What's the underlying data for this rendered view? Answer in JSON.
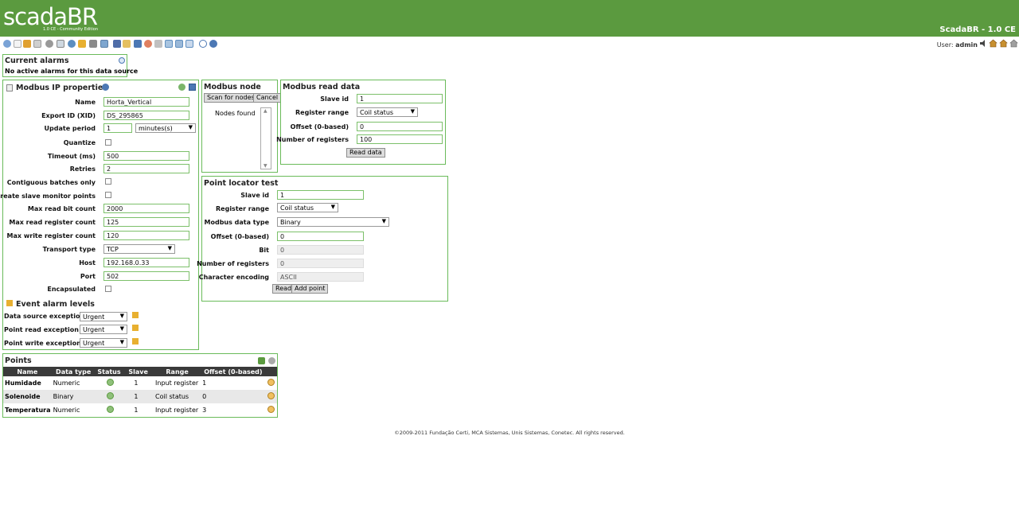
{
  "header": {
    "logo": "scadaBR",
    "logo_sub": "1.0 CE - Community Edition",
    "title": "ScadaBR - 1.0 CE"
  },
  "toolbar": {
    "user_label": "User:",
    "user_name": "admin"
  },
  "alarms": {
    "title": "Current alarms",
    "message": "No active alarms for this data source"
  },
  "props": {
    "title": "Modbus IP properties",
    "fields": {
      "name": {
        "label": "Name",
        "value": "Horta_Vertical"
      },
      "xid": {
        "label": "Export ID (XID)",
        "value": "DS_295865"
      },
      "period": {
        "label": "Update period",
        "value": "1",
        "unit": "minutes(s)"
      },
      "quantize": {
        "label": "Quantize"
      },
      "timeout": {
        "label": "Timeout (ms)",
        "value": "500"
      },
      "retries": {
        "label": "Retries",
        "value": "2"
      },
      "contiguous": {
        "label": "Contiguous batches only"
      },
      "slave_monitor": {
        "label": "Create slave monitor points"
      },
      "max_bit": {
        "label": "Max read bit count",
        "value": "2000"
      },
      "max_reg": {
        "label": "Max read register count",
        "value": "125"
      },
      "max_write": {
        "label": "Max write register count",
        "value": "120"
      },
      "transport": {
        "label": "Transport type",
        "value": "TCP"
      },
      "host": {
        "label": "Host",
        "value": "192.168.0.33"
      },
      "port": {
        "label": "Port",
        "value": "502"
      },
      "encapsulated": {
        "label": "Encapsulated"
      }
    }
  },
  "events": {
    "title": "Event alarm levels",
    "rows": [
      {
        "label": "Data source exception",
        "value": "Urgent"
      },
      {
        "label": "Point read exception",
        "value": "Urgent"
      },
      {
        "label": "Point write exception",
        "value": "Urgent"
      }
    ]
  },
  "scan": {
    "title": "Modbus node scan",
    "scan_btn": "Scan for nodes",
    "cancel_btn": "Cancel",
    "nodes_label": "Nodes found"
  },
  "read": {
    "title": "Modbus read data",
    "slave_label": "Slave id",
    "slave": "1",
    "range_label": "Register range",
    "range": "Coil status",
    "offset_label": "Offset (0-based)",
    "offset": "0",
    "num_label": "Number of registers",
    "num": "100",
    "btn": "Read data"
  },
  "locator": {
    "title": "Point locator test",
    "slave_label": "Slave id",
    "slave": "1",
    "range_label": "Register range",
    "range": "Coil status",
    "dtype_label": "Modbus data type",
    "dtype": "Binary",
    "offset_label": "Offset (0-based)",
    "offset": "0",
    "bit_label": "Bit",
    "bit": "0",
    "num_label": "Number of registers",
    "num": "0",
    "enc_label": "Character encoding",
    "enc": "ASCII",
    "read_btn": "Read",
    "add_btn": "Add point"
  },
  "points": {
    "title": "Points",
    "headers": [
      "Name",
      "Data type",
      "Status",
      "Slave",
      "Range",
      "Offset (0-based)"
    ],
    "rows": [
      {
        "name": "Humidade",
        "type": "Numeric",
        "slave": "1",
        "range": "Input register",
        "offset": "1"
      },
      {
        "name": "Solenoide",
        "type": "Binary",
        "slave": "1",
        "range": "Coil status",
        "offset": "0"
      },
      {
        "name": "Temperatura",
        "type": "Numeric",
        "slave": "1",
        "range": "Input register",
        "offset": "3"
      }
    ]
  },
  "footer": "©2009-2011 Fundação Certi, MCA Sistemas, Unis Sistemas, Conetec. All rights reserved.",
  "colors": {
    "header_bg": "#5b9a3f",
    "panel_border": "#6abb5a",
    "table_header": "#3a3a3a"
  }
}
